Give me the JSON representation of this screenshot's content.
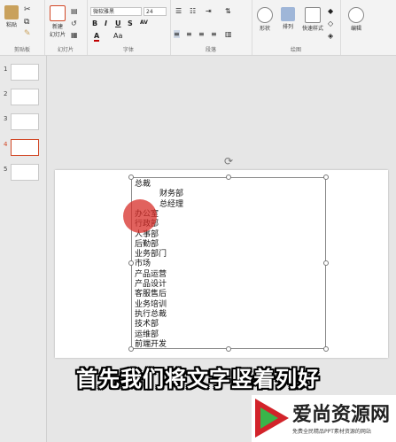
{
  "ribbon": {
    "clipboard": {
      "paste": "粘贴",
      "label": "剪贴板"
    },
    "slides": {
      "new_slide": "新建\n幻灯片",
      "label": "幻灯片"
    },
    "font": {
      "font_name": "微软雅黑",
      "font_size": "24",
      "label": "字体",
      "bold": "B",
      "italic": "I",
      "underline": "U",
      "strike": "S",
      "spacing": "AV",
      "color": "A"
    },
    "paragraph": {
      "label": "段落"
    },
    "drawing": {
      "shapes": "形状",
      "arrange": "排列",
      "quick_styles": "快速样式",
      "label": "绘图"
    },
    "editing": {
      "edit": "编辑"
    }
  },
  "thumbnails": [
    {
      "num": "1",
      "active": false
    },
    {
      "num": "2",
      "active": false
    },
    {
      "num": "3",
      "active": false
    },
    {
      "num": "4",
      "active": true
    },
    {
      "num": "5",
      "active": false
    }
  ],
  "slide_lines": [
    {
      "text": "总裁",
      "indent": 0
    },
    {
      "text": "财务部",
      "indent": 28
    },
    {
      "text": "总经理",
      "indent": 28
    },
    {
      "text": "办公室",
      "indent": 0
    },
    {
      "text": "行政部",
      "indent": 0
    },
    {
      "text": "人事部",
      "indent": 0
    },
    {
      "text": "后勤部",
      "indent": 0
    },
    {
      "text": "业务部门",
      "indent": 0
    },
    {
      "text": "市场",
      "indent": 0
    },
    {
      "text": "产品运营",
      "indent": 0
    },
    {
      "text": "产品设计",
      "indent": 0
    },
    {
      "text": "客服售后",
      "indent": 0
    },
    {
      "text": "业务培训",
      "indent": 0
    },
    {
      "text": "执行总裁",
      "indent": 0
    },
    {
      "text": "技术部",
      "indent": 0
    },
    {
      "text": "运维部",
      "indent": 0
    },
    {
      "text": "前端开发",
      "indent": 0
    }
  ],
  "caption": "首先我们将文字竖着列好",
  "watermark": {
    "title": "爱尚资源网",
    "subtitle": "免费全民精品PPT素材资源的网站"
  }
}
